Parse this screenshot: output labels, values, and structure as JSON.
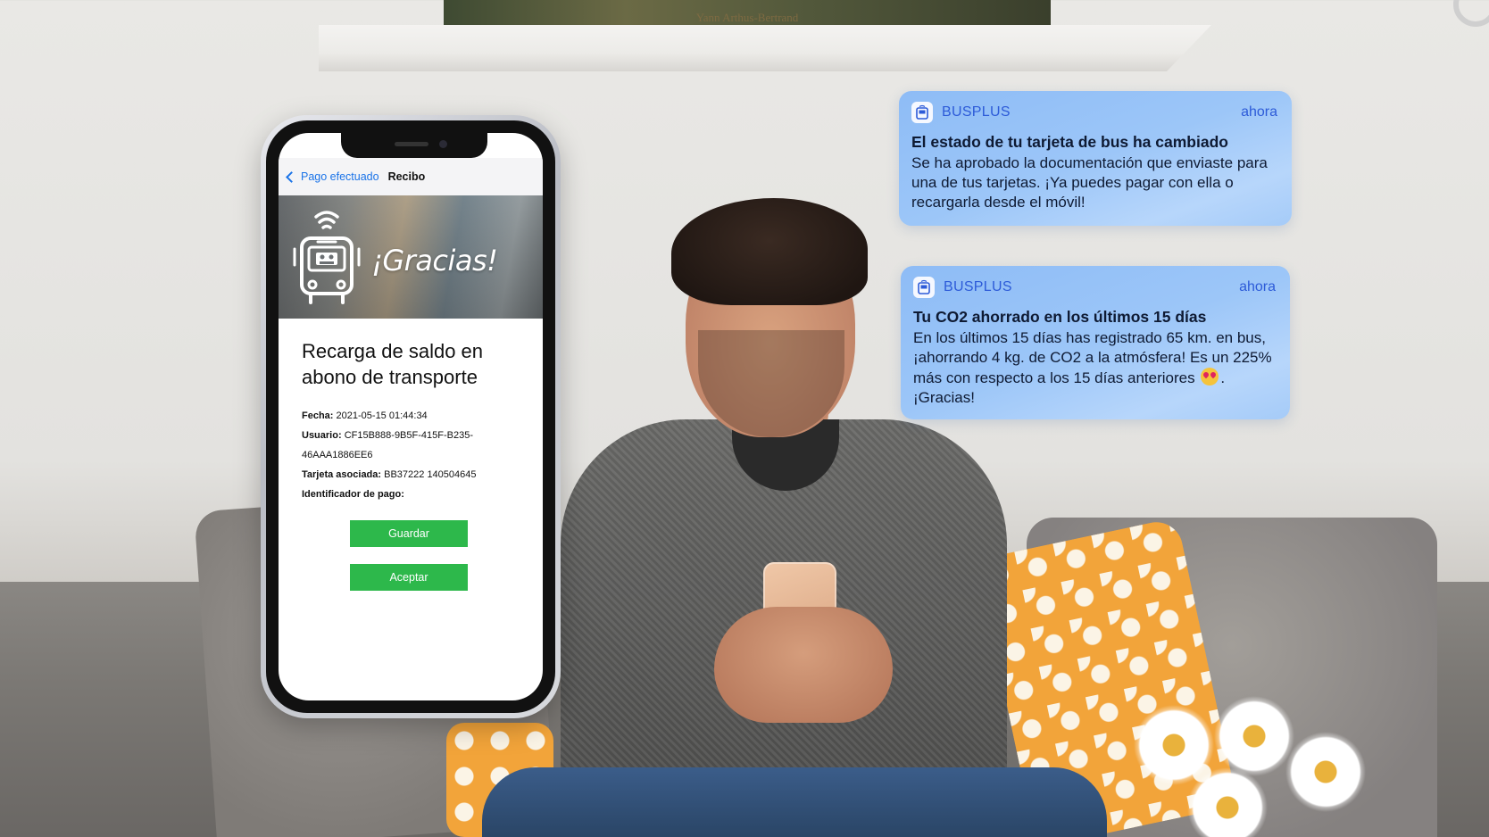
{
  "background": {
    "painting_caption": "Yann Arthus-Bertrand"
  },
  "phone": {
    "nav": {
      "back_label": "Pago efectuado",
      "title": "Recibo"
    },
    "hero": {
      "thanks_text": "¡Gracias!"
    },
    "receipt": {
      "title": "Recarga de saldo en abono de transporte",
      "fields": [
        {
          "label": "Fecha:",
          "value": "2021-05-15 01:44:34"
        },
        {
          "label": "Usuario:",
          "value": "CF15B888-9B5F-415F-B235-46AAA1886EE6"
        },
        {
          "label": "Tarjeta asociada:",
          "value": "BB37222 140504645"
        },
        {
          "label": "Identificador de pago:",
          "value": ""
        }
      ],
      "save_button": "Guardar",
      "accept_button": "Aceptar"
    }
  },
  "notifications": [
    {
      "app_name": "BUSPLUS",
      "time": "ahora",
      "title": "El estado de tu tarjeta de bus ha cambiado",
      "body": "Se ha aprobado la documentación que enviaste para una de tus tarjetas. ¡Ya puedes pagar con ella o recargarla desde el móvil!"
    },
    {
      "app_name": "BUSPLUS",
      "time": "ahora",
      "title": "Tu CO2 ahorrado en los últimos 15 días",
      "body_before_emoji": "En los últimos 15 días has registrado 65 km. en bus, ¡ahorrando 4 kg. de CO2 a la atmósfera! Es un 225% más con respecto a los 15 días anteriores",
      "body_after_emoji": ". ¡Gracias!"
    }
  ],
  "colors": {
    "button_green": "#2db84b",
    "link_blue": "#1a73e8",
    "notification_accent": "#2d5bd8"
  },
  "icons": [
    "back-chevron-icon",
    "bus-wifi-icon",
    "busplus-app-icon",
    "heart-eyes-emoji-icon"
  ]
}
